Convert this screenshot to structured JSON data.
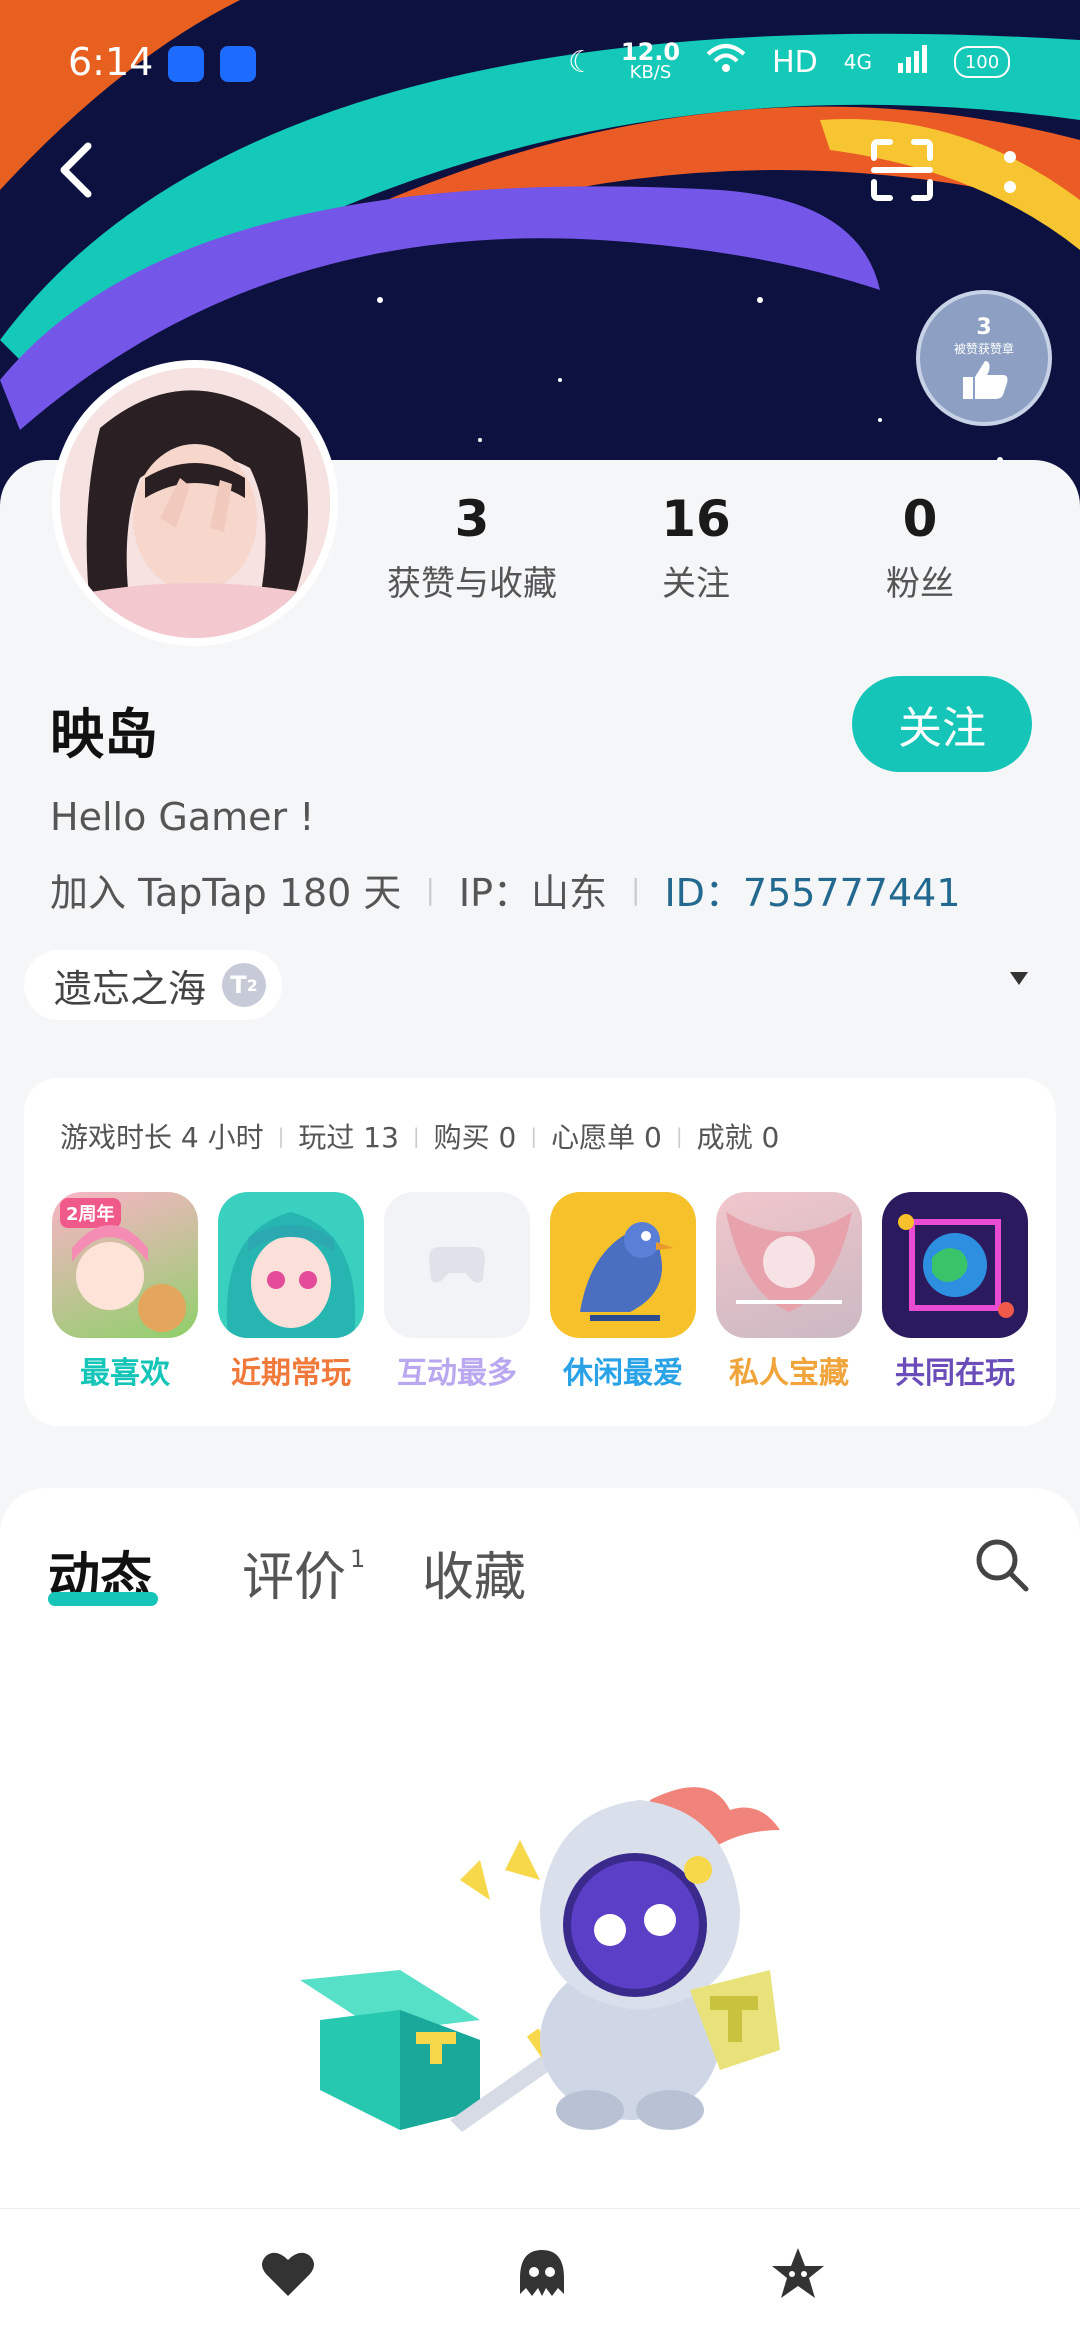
{
  "status_bar": {
    "time": "6:14",
    "speed_value": "12.0",
    "speed_unit": "KB/S",
    "hd": "HD",
    "net": "4G",
    "battery": "100"
  },
  "badge": {
    "count": "3",
    "caption": "被赞获赞章"
  },
  "stats": [
    {
      "num": "3",
      "label": "获赞与收藏"
    },
    {
      "num": "16",
      "label": "关注"
    },
    {
      "num": "0",
      "label": "粉丝"
    }
  ],
  "profile": {
    "name": "映岛",
    "follow_label": "关注",
    "bio": "Hello Gamer !",
    "join": "加入 TapTap 180 天",
    "ip": "IP：山东",
    "id": "ID：755777441"
  },
  "tag": {
    "label": "遗忘之海",
    "level": "2"
  },
  "games_summary": [
    "游戏时长 4 小时",
    "玩过 13",
    "购买 0",
    "心愿单 0",
    "成就 0"
  ],
  "games": [
    {
      "label": "最喜欢",
      "color": "#15c5b8"
    },
    {
      "label": "近期常玩",
      "color": "#f07a3c"
    },
    {
      "label": "互动最多",
      "color": "#b9a8ef"
    },
    {
      "label": "休闲最爱",
      "color": "#2aa2e6"
    },
    {
      "label": "私人宝藏",
      "color": "#f0a43c"
    },
    {
      "label": "共同在玩",
      "color": "#6a4db8"
    }
  ],
  "game_icon1_text": "2周年",
  "tabs": [
    {
      "label": "动态"
    },
    {
      "label": "评价",
      "badge": "1"
    },
    {
      "label": "收藏"
    }
  ],
  "colors": {
    "accent": "#15c5b8",
    "banner": "#0d1140"
  }
}
